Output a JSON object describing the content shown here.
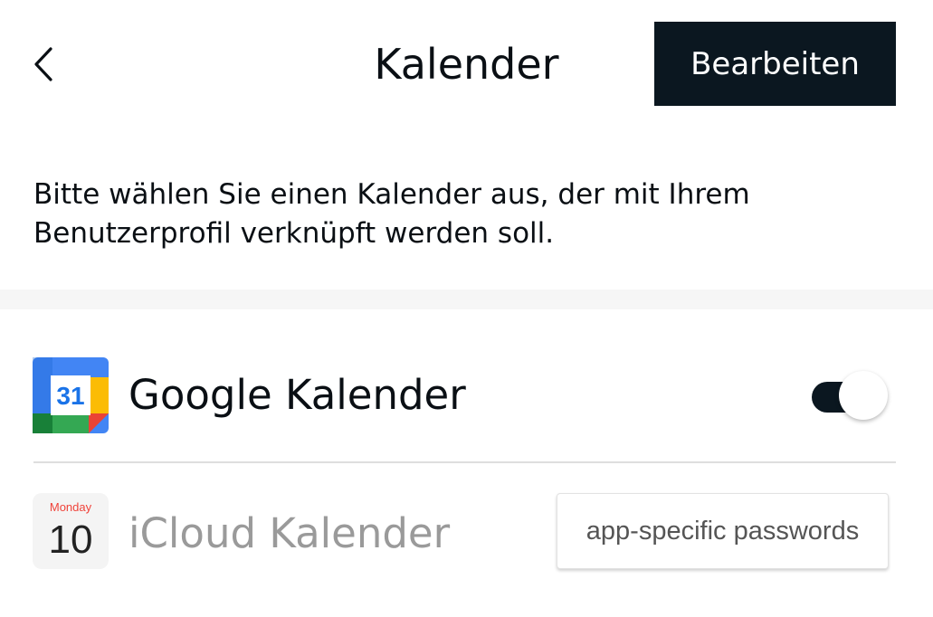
{
  "header": {
    "title": "Kalender",
    "edit_label": "Bearbeiten",
    "back_icon": "chevron-left-icon"
  },
  "description": "Bitte wählen Sie einen Kalender aus, der mit Ihrem Benutzerprofil verknüpft werden soll.",
  "calendars": [
    {
      "label": "Google Kalender",
      "icon": "google-calendar-icon",
      "icon_text": "31",
      "enabled": true
    },
    {
      "label": "iCloud Kalender",
      "icon": "apple-calendar-icon",
      "icon_day_name": "Monday",
      "icon_day_number": "10",
      "action_label": "app-specific passwords"
    }
  ],
  "colors": {
    "primary_dark": "#0b1720",
    "disabled_text": "#9a9a9a",
    "apple_red": "#f0433a",
    "google_blue": "#4285f4",
    "google_green": "#34a853",
    "google_yellow": "#fbbc04",
    "google_red": "#ea4335"
  }
}
